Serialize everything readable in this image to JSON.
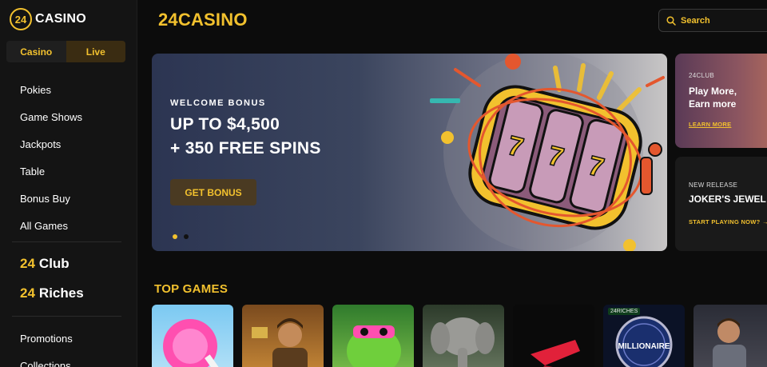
{
  "brand": {
    "logo_mark": "24",
    "logo_text": "CASINO",
    "header_title": "24CASINO"
  },
  "sidebar": {
    "toggle": [
      {
        "label": "Casino"
      },
      {
        "label": "Live"
      }
    ],
    "items": [
      {
        "label": "Pokies"
      },
      {
        "label": "Game Shows"
      },
      {
        "label": "Jackpots"
      },
      {
        "label": "Table"
      },
      {
        "label": "Bonus Buy"
      },
      {
        "label": "All Games"
      }
    ],
    "clubs": [
      {
        "num": "24",
        "label": "Club"
      },
      {
        "num": "24",
        "label": "Riches"
      }
    ],
    "items2": [
      {
        "label": "Promotions"
      },
      {
        "label": "Collections"
      }
    ]
  },
  "search": {
    "label": "Search"
  },
  "hero": {
    "eyebrow": "WELCOME BONUS",
    "line1": "UP TO $4,500",
    "line2": "+ 350 FREE SPINS",
    "button": "GET BONUS",
    "slides": 2,
    "active_slide": 1
  },
  "promo1": {
    "eyebrow": "24CLUB",
    "title_1": "Play More,",
    "title_2": "Earn more",
    "link": "LEARN MORE"
  },
  "promo2": {
    "eyebrow": "NEW RELEASE",
    "title": "JOKER'S JEWEL",
    "link": "START PLAYING NOW? →"
  },
  "top_games": {
    "title": "TOP GAMES",
    "tiles": [
      {
        "icon": "lollipop-art"
      },
      {
        "icon": "explorer-art"
      },
      {
        "icon": "frog-art"
      },
      {
        "icon": "elephant-art"
      },
      {
        "icon": "red-shape-art"
      },
      {
        "icon": "millionaire-art",
        "badge": "24RICHES",
        "label": "MILLIONAIRE"
      },
      {
        "icon": "man-portrait-art"
      }
    ]
  },
  "colors": {
    "accent": "#f2c12e",
    "bg": "#0c0c0c",
    "sidebar": "#141414"
  }
}
